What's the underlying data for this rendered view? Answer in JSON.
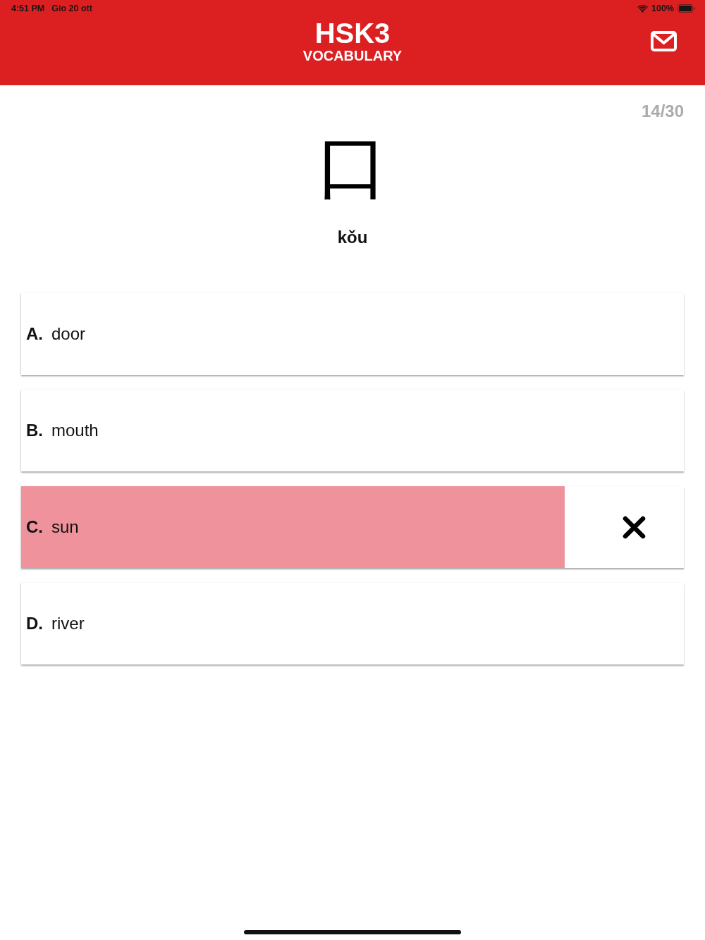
{
  "status_bar": {
    "time": "4:51 PM",
    "date": "Gio 20 ott",
    "battery": "100%"
  },
  "header": {
    "title": "HSK3",
    "subtitle": "VOCABULARY"
  },
  "progress": "14/30",
  "question": {
    "character": "口",
    "pinyin": "kǒu"
  },
  "options": [
    {
      "letter": "A.",
      "text": "door",
      "selected": false
    },
    {
      "letter": "B.",
      "text": "mouth",
      "selected": false
    },
    {
      "letter": "C.",
      "text": "sun",
      "selected": true,
      "correct": false,
      "level": 0.82
    },
    {
      "letter": "D.",
      "text": "river",
      "selected": false
    }
  ]
}
